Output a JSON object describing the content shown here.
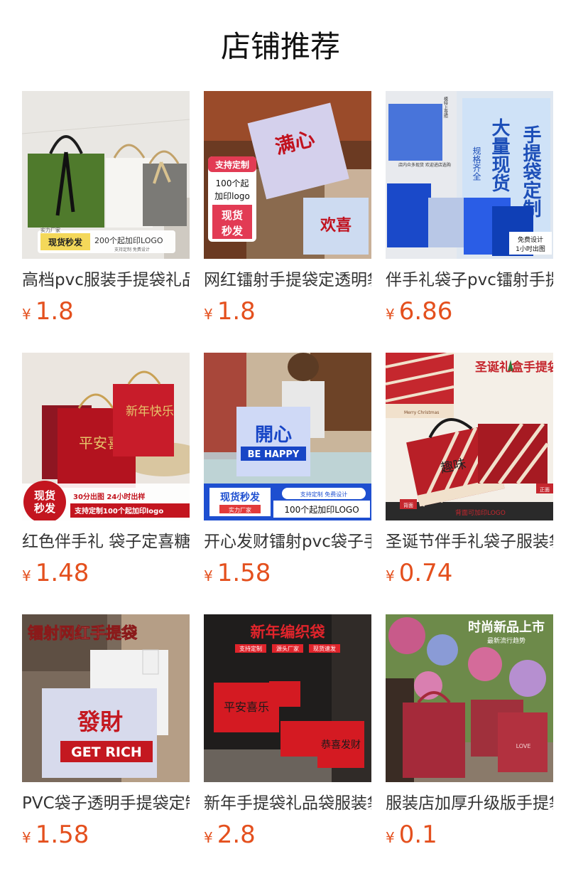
{
  "section": {
    "title": "店铺推荐"
  },
  "products": [
    {
      "name": "高档pvc服装手提袋礼品袋",
      "currency": "¥",
      "price": "1.8",
      "img": {
        "badge": "现货秒发",
        "sub": "200个起加印LOGO",
        "tag": "实力厂家",
        "note": "支持定制 免费设计"
      }
    },
    {
      "name": "网红镭射手提袋定透明袋",
      "currency": "¥",
      "price": "1.8",
      "img": {
        "bag_text": "满心",
        "bag_text_2": "欢喜",
        "tag1": "支持定制",
        "tag2": "100个起",
        "tag3": "加印logo",
        "tag4": "现货",
        "tag5": "秒发"
      }
    },
    {
      "name": "伴手礼袋子pvc镭射手提袋",
      "currency": "¥",
      "price": "6.86",
      "img": {
        "headline": "手提袋定制",
        "headline2": "大量现货",
        "badge": "规格齐全",
        "note1": "免费设计",
        "note2": "1小时出图",
        "strip": "店内众多现货 欢迎进店选购",
        "side": "模特上身照"
      }
    },
    {
      "name": "红色伴手礼 袋子定喜糖袋",
      "currency": "¥",
      "price": "1.48",
      "img": {
        "bag_text": "平安喜樂",
        "bag_text_2": "新年快乐",
        "badge1": "现货",
        "badge2": "秒发",
        "line1": "30分出图 24小时出样",
        "line2": "支持定制100个起加印logo"
      }
    },
    {
      "name": "开心发财镭射pvc袋子手提袋",
      "currency": "¥",
      "price": "1.58",
      "img": {
        "bag_text": "開心",
        "bag_text_2": "BE HAPPY",
        "badge": "现货秒发",
        "tag": "实力厂家",
        "pill": "支持定制 免费设计",
        "sub": "100个起加印LOGO"
      }
    },
    {
      "name": "圣诞节伴手礼袋子服装袋",
      "currency": "¥",
      "price": "0.74",
      "img": {
        "headline": "圣诞礼盒手提袋",
        "brand": "Merry Christmas",
        "script": "趣味",
        "label1": "正面",
        "label2": "背面",
        "note": "背面可加印LOGO"
      }
    },
    {
      "name": "PVC袋子透明手提袋定制",
      "currency": "¥",
      "price": "1.58",
      "img": {
        "headline": "镭射网红手提袋",
        "bag_text": "發財",
        "bag_text_2": "GET RICH"
      }
    },
    {
      "name": "新年手提袋礼品袋服装袋",
      "currency": "¥",
      "price": "2.8",
      "img": {
        "headline": "新年编织袋",
        "tags": [
          "支持定制",
          "源头厂家",
          "现货速发"
        ],
        "bag_text": "平安喜乐",
        "bag_text_2": "恭喜发财"
      }
    },
    {
      "name": "服装店加厚升级版手提袋",
      "currency": "¥",
      "price": "0.1",
      "img": {
        "headline": "时尚新品上市",
        "sub": "最新流行趋势",
        "bag_text": "LOVE"
      }
    }
  ],
  "colors": {
    "price": "#e4501e",
    "title": "#111111",
    "name": "#333333"
  }
}
